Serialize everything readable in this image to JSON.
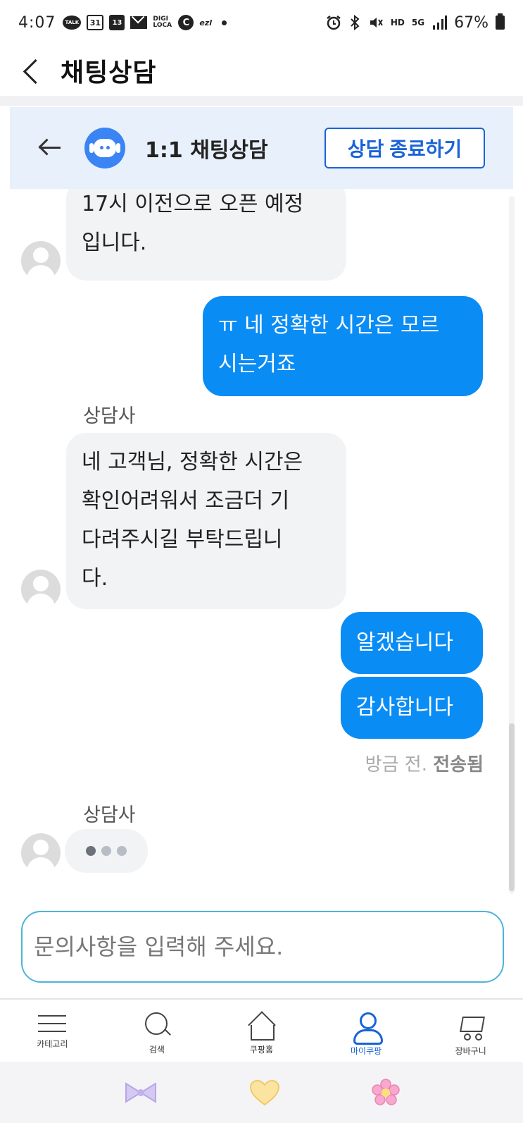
{
  "status_bar": {
    "time": "4:07",
    "battery": "67%",
    "icons": [
      "talk-icon",
      "calendar-31-icon",
      "calendar-13-icon",
      "mail-icon",
      "digi-loca-icon",
      "c-icon",
      "ezl-icon",
      "dot-icon",
      "alarm-icon",
      "bluetooth-icon",
      "mute-icon",
      "hd-voice-icon",
      "5g-icon",
      "signal-icon",
      "battery-icon"
    ],
    "cal1": "31",
    "cal2": "13",
    "digi": "DIGI LOCA",
    "c": "C",
    "ezl": "ezl",
    "talk": "TALK",
    "hd": "HD",
    "fiveg": "5G"
  },
  "header": {
    "title": "채팅상담"
  },
  "chat_header": {
    "title": "1:1 채팅상담",
    "end_button": "상담 종료하기"
  },
  "messages": {
    "agent1": "17시 이전으로 오픈 예정\n입니다.",
    "user1": "ㅠ 네 정확한 시간은 모르\n시는거죠",
    "sender1": "상담사",
    "agent2": "네 고객님, 정확한 시간은\n확인어려워서 조금더 기\n다려주시길 부탁드립니\n다.",
    "user2": "알겠습니다",
    "user3": "감사합니다",
    "status_prefix": "방금 전.",
    "status_sent": "전송됨",
    "sender2": "상담사"
  },
  "input": {
    "placeholder": "문의사항을 입력해 주세요."
  },
  "bottom_nav": {
    "items": [
      {
        "label": "카테고리",
        "icon": "menu-icon"
      },
      {
        "label": "검색",
        "icon": "search-icon"
      },
      {
        "label": "쿠팡홈",
        "icon": "home-icon"
      },
      {
        "label": "마이쿠팡",
        "icon": "user-icon",
        "active": true
      },
      {
        "label": "장바구니",
        "icon": "cart-icon"
      }
    ],
    "active_color": "#1a63d8"
  },
  "system_bar": {
    "icons": [
      "bow-icon",
      "heart-icon",
      "flower-icon"
    ]
  },
  "colors": {
    "user_bubble": "#0a8cf5",
    "agent_bubble": "#f2f3f5",
    "chat_header_bg": "#e8f0fc",
    "accent": "#1a63d8"
  }
}
